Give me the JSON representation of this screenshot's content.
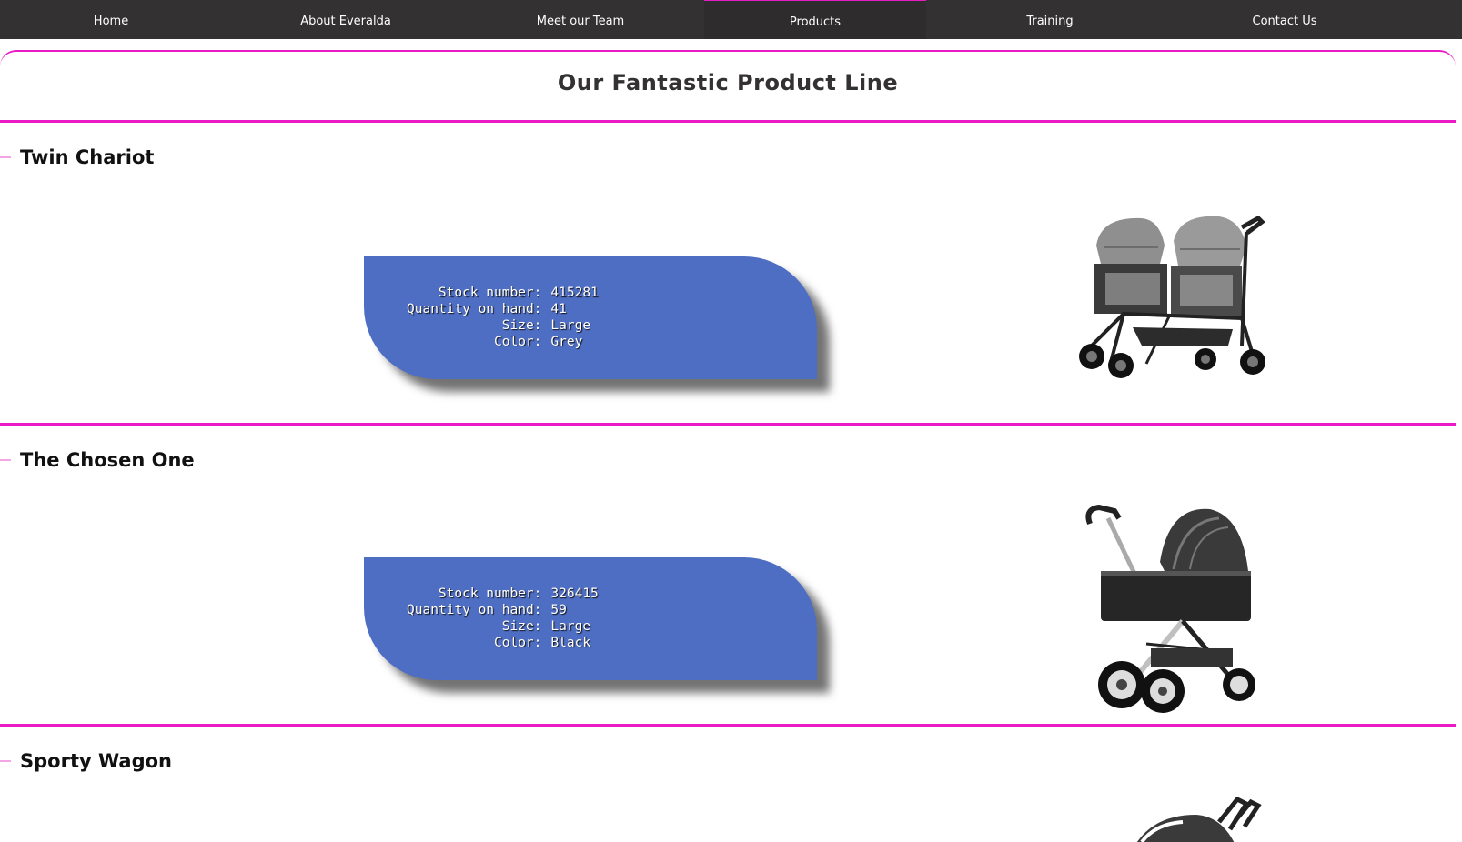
{
  "nav": {
    "items": [
      {
        "label": "Home"
      },
      {
        "label": "About Everalda"
      },
      {
        "label": "Meet our Team"
      },
      {
        "label": "Products"
      },
      {
        "label": "Training"
      },
      {
        "label": "Contact Us"
      }
    ],
    "active": "Products"
  },
  "page": {
    "title": "Our Fantastic Product Line"
  },
  "labels": {
    "stock": "Stock number:",
    "qty": "Quantity on hand:",
    "size": "Size:",
    "color": "Color:"
  },
  "products": [
    {
      "name": "Twin Chariot",
      "stock_number": "415281",
      "quantity": "41",
      "size": "Large",
      "color": "Grey",
      "image_icon": "twin-stroller-icon"
    },
    {
      "name": "The Chosen One",
      "stock_number": "326415",
      "quantity": "59",
      "size": "Large",
      "color": "Black",
      "image_icon": "stroller-icon"
    },
    {
      "name": "Sporty Wagon",
      "image_icon": "stroller-icon"
    }
  ],
  "colors": {
    "accent": "#e81bc6",
    "nav_bg": "#333132",
    "card_bg": "#4e6ec4"
  }
}
